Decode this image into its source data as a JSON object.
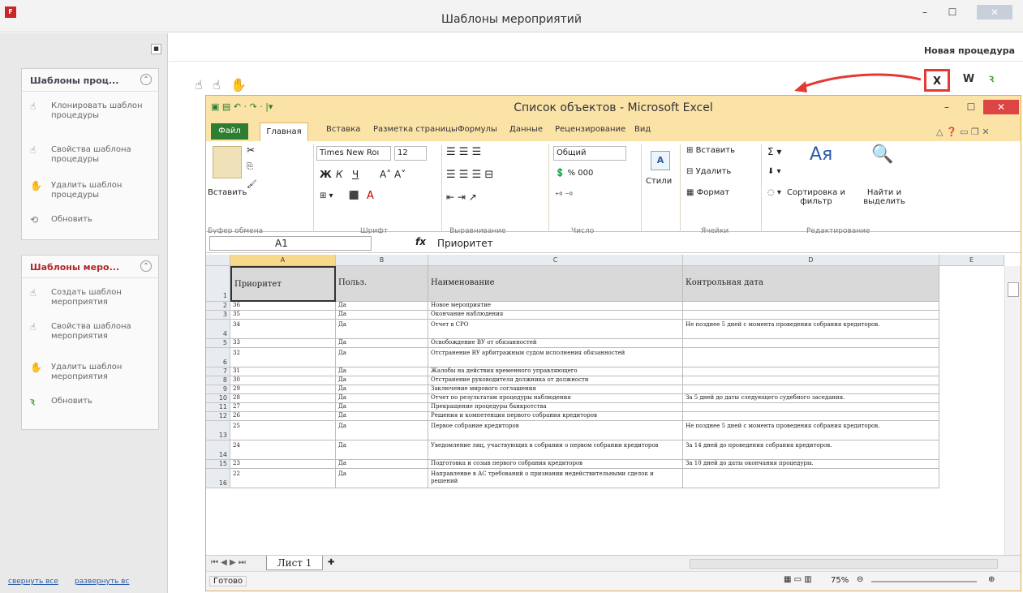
{
  "window": {
    "title": "Шаблоны мероприятий"
  },
  "sidebar": {
    "panel1": {
      "title": "Шаблоны проц...",
      "items": [
        {
          "icon": "clone-icon",
          "label": "Клонировать шаблон процедуры"
        },
        {
          "icon": "properties-icon",
          "label": "Свойства шаблона процедуры"
        },
        {
          "icon": "delete-icon",
          "label": "Удалить шаблон процедуры"
        },
        {
          "icon": "refresh-icon",
          "label": "Обновить"
        }
      ]
    },
    "panel2": {
      "title": "Шаблоны меро...",
      "items": [
        {
          "icon": "create-icon",
          "label": "Создать шаблон мероприятия"
        },
        {
          "icon": "properties-icon",
          "label": "Свойства шаблона мероприятия"
        },
        {
          "icon": "delete-icon",
          "label": "Удалить шаблон мероприятия"
        },
        {
          "icon": "refresh-icon",
          "label": "Обновить"
        }
      ]
    },
    "collapse_all": "свернуть все",
    "expand_all": "развернуть вс"
  },
  "main": {
    "new_procedure": "Новая процедура",
    "export_excel": "X",
    "export_word": "W",
    "refresh": "ꝛ"
  },
  "excel": {
    "title": "Список объектов  -  Microsoft Excel",
    "tabs": {
      "file": "Файл",
      "home": "Главная",
      "insert": "Вставка",
      "layout": "Разметка страницы",
      "formulas": "Формулы",
      "data": "Данные",
      "review": "Рецензирование",
      "view": "Вид"
    },
    "ribbon": {
      "paste": "Вставить",
      "clipboard": "Буфер обмена",
      "font_name": "Times New Roı",
      "font_size": "12",
      "font_group": "Шрифт",
      "alignment": "Выравнивание",
      "number_format": "Общий",
      "number": "Число",
      "styles": "Стили",
      "insert": "Вставить",
      "delete": "Удалить",
      "format": "Формат",
      "cells": "Ячейки",
      "sort": "Сортировка и фильтр",
      "find": "Найти и выделить",
      "editing": "Редактирование"
    },
    "name_box": "A1",
    "formula": "Приоритет",
    "columns": [
      "A",
      "B",
      "C",
      "D",
      "E"
    ],
    "header_row": [
      "Приоритет",
      "Польз.",
      "Наименование",
      "Контрольная дата"
    ],
    "rows": [
      {
        "n": "2",
        "a": "36",
        "b": "Да",
        "c": "Новое мероприятие",
        "d": ""
      },
      {
        "n": "3",
        "a": "35",
        "b": "Да",
        "c": "Окончание наблюдения",
        "d": ""
      },
      {
        "n": "4",
        "a": "34",
        "b": "Да",
        "c": "Отчет в СРО",
        "d": "Не позднее 5 дней с момента проведения собрания кредиторов."
      },
      {
        "n": "5",
        "a": "33",
        "b": "Да",
        "c": "Освобождение ВУ от обязанностей",
        "d": ""
      },
      {
        "n": "6",
        "a": "32",
        "b": "Да",
        "c": "Отстранение ВУ арбитражным судом исполнения обязанностей",
        "d": ""
      },
      {
        "n": "7",
        "a": "31",
        "b": "Да",
        "c": "Жалобы на действия временного управляющего",
        "d": ""
      },
      {
        "n": "8",
        "a": "30",
        "b": "Да",
        "c": "Отстранение руководителя должника от должности",
        "d": ""
      },
      {
        "n": "9",
        "a": "29",
        "b": "Да",
        "c": "Заключение мирового соглашения",
        "d": ""
      },
      {
        "n": "10",
        "a": "28",
        "b": "Да",
        "c": "Отчет по результатам процедуры наблюдения",
        "d": "За 5 дней до даты следующего судебного заседания."
      },
      {
        "n": "11",
        "a": "27",
        "b": "Да",
        "c": "Прекращение процедуры банкротства",
        "d": ""
      },
      {
        "n": "12",
        "a": "26",
        "b": "Да",
        "c": "Решения и компетенция первого собрания кредиторов",
        "d": ""
      },
      {
        "n": "13",
        "a": "25",
        "b": "Да",
        "c": "Первое собрание кредиторов",
        "d": "Не позднее 5 дней с момента проведения собрания кредиторов."
      },
      {
        "n": "14",
        "a": "24",
        "b": "Да",
        "c": "Уведомление лиц, участвующих в собрании о первом собрании кредиторов",
        "d": "За 14 дней до проведения собрания кредиторов."
      },
      {
        "n": "15",
        "a": "23",
        "b": "Да",
        "c": "Подготовка и созыв первого собрания кредиторов",
        "d": "За 10 дней до даты окончания процедуры."
      },
      {
        "n": "16",
        "a": "22",
        "b": "Да",
        "c": "Направление в АС требований о признании недействительными сделок и решений",
        "d": ""
      }
    ],
    "sheet_tab": "Лист 1",
    "status": "Готово",
    "zoom": "75%"
  }
}
